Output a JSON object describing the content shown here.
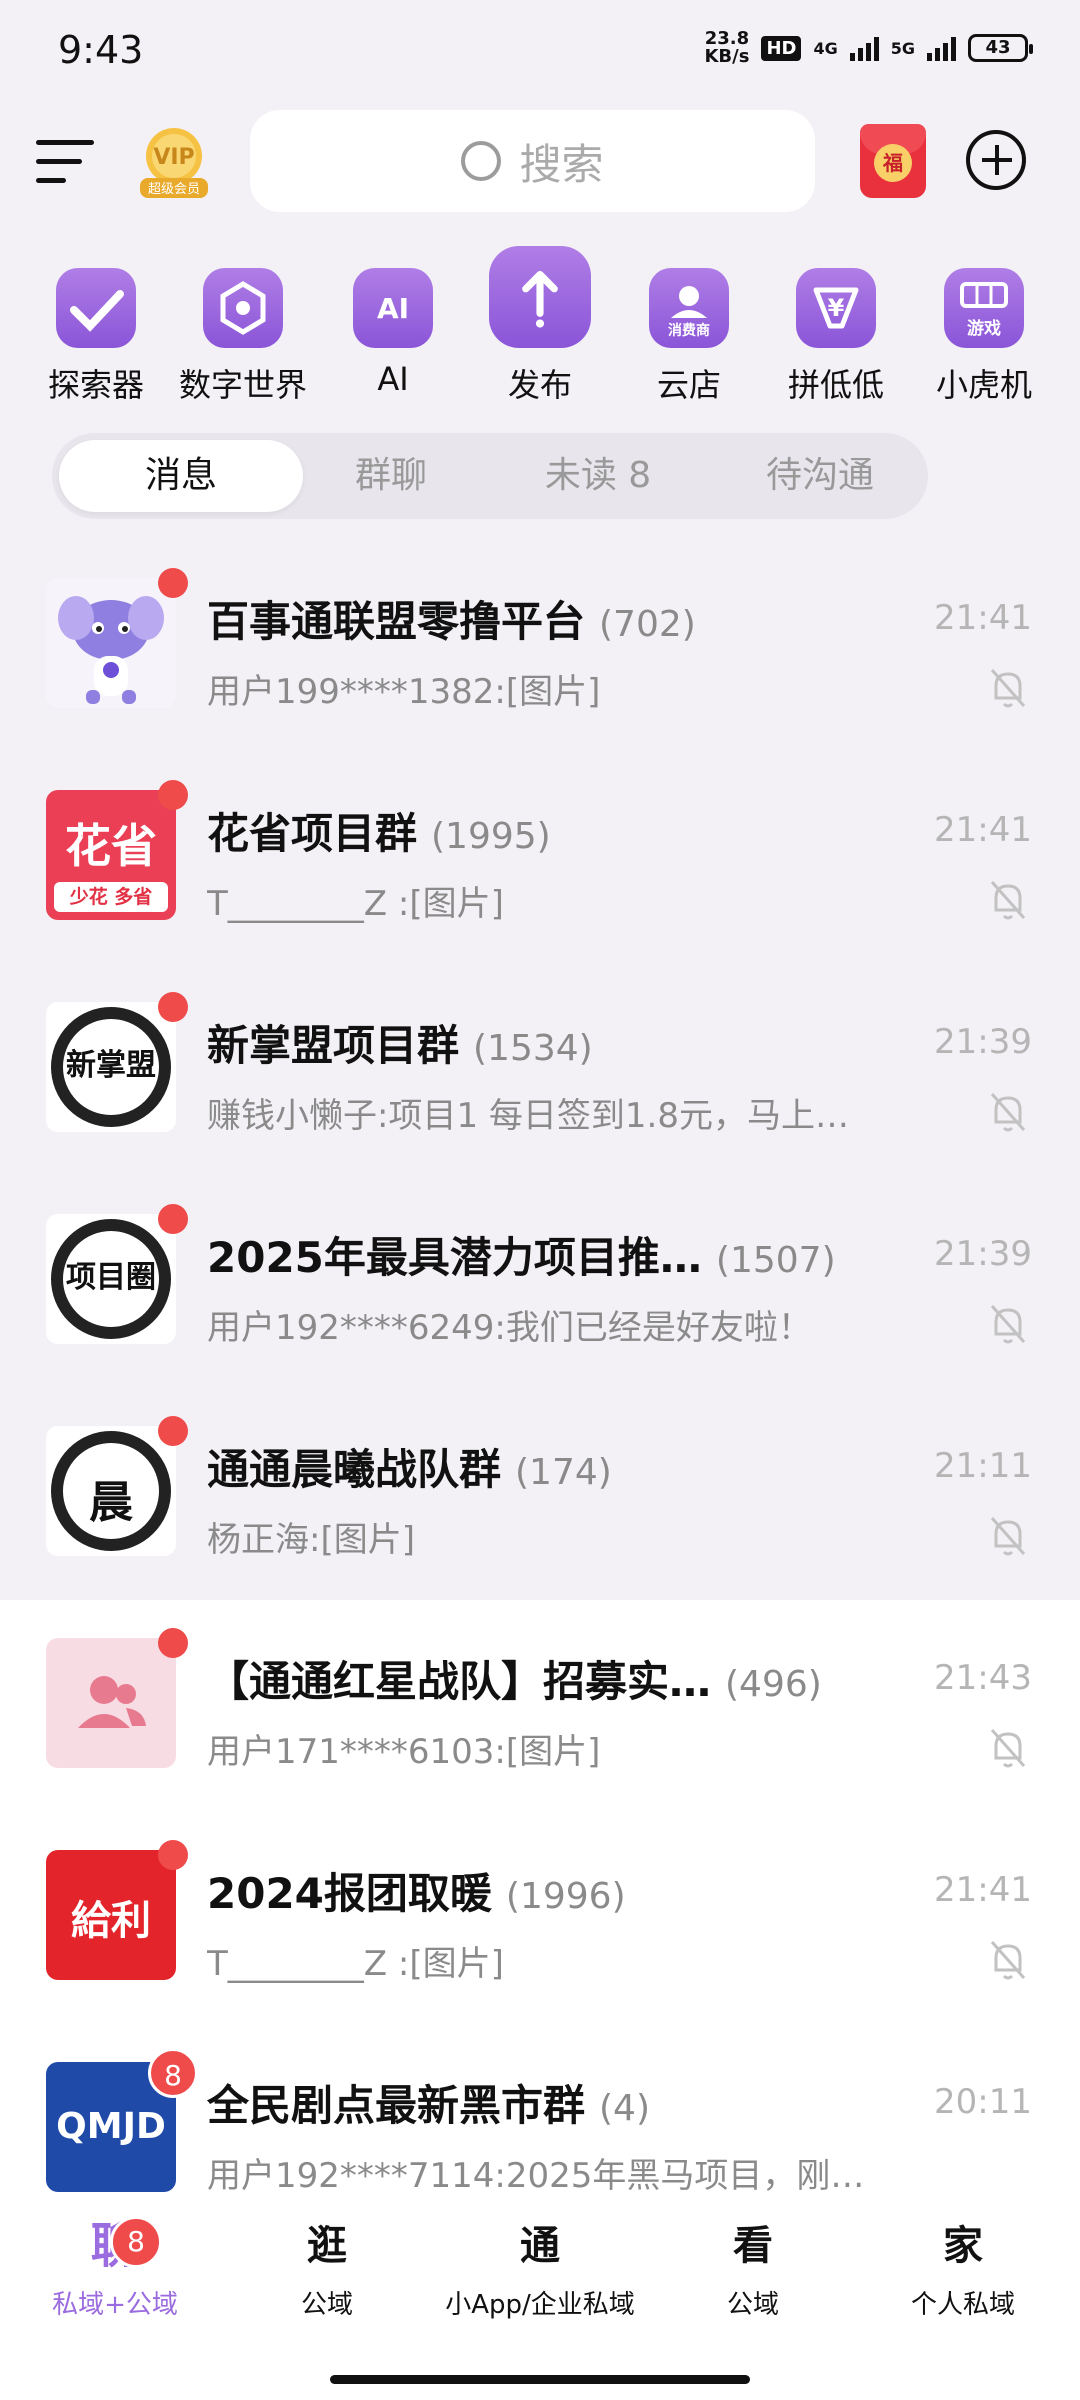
{
  "status_bar": {
    "time": "9:43",
    "net_speed_value": "23.8",
    "net_speed_unit": "KB/s",
    "hd": "HD",
    "net1": "4G",
    "net2": "5G",
    "battery": "43"
  },
  "header": {
    "vip_label": "超级会员",
    "search_placeholder": "搜索",
    "redpacket_char": "福"
  },
  "shortcuts": [
    {
      "label": "探索器",
      "icon": "explorer-icon"
    },
    {
      "label": "数字世界",
      "icon": "digital-world-icon"
    },
    {
      "label": "AI",
      "icon": "ai-icon",
      "glyph": "AI"
    },
    {
      "label": "发布",
      "icon": "publish-icon"
    },
    {
      "label": "云店",
      "icon": "cloud-store-icon",
      "glyph": "消费商"
    },
    {
      "label": "拼低低",
      "icon": "pindidi-icon",
      "glyph": "¥"
    },
    {
      "label": "小虎机",
      "icon": "tiger-machine-icon",
      "glyph": "游戏"
    }
  ],
  "tabs": [
    "消息",
    "群聊",
    "未读 8",
    "待沟通"
  ],
  "chats": [
    {
      "title": "百事通联盟零撸平台",
      "members": "(702)",
      "time": "21:41",
      "preview": "用户199****1382:[图片]",
      "avatar": "mascot"
    },
    {
      "title": "花省项目群",
      "members": "(1995)",
      "time": "21:41",
      "preview": "T________Z :[图片]",
      "avatar": "huasheng",
      "avatar_text": "花省",
      "avatar_sub": "少花 多省"
    },
    {
      "title": "新掌盟项目群",
      "members": "(1534)",
      "time": "21:39",
      "preview": "赚钱小懒子:项目1 每日签到1.8元，马上…",
      "avatar": "ink",
      "avatar_text": "新掌盟"
    },
    {
      "title": "2025年最具潜力项目推…",
      "members": "(1507)",
      "time": "21:39",
      "preview": "用户192****6249:我们已经是好友啦！",
      "avatar": "ink",
      "avatar_text": "项目圈"
    },
    {
      "title": "通通晨曦战队群",
      "members": "(174)",
      "time": "21:11",
      "preview": "杨正海:[图片]",
      "avatar": "ink",
      "avatar_text": "晨"
    },
    {
      "title": "【通通红星战队】招募实…",
      "members": "(496)",
      "time": "21:43",
      "preview": "用户171****6103:[图片]",
      "avatar": "group"
    },
    {
      "title": "2024报团取暖",
      "members": "(1996)",
      "time": "21:41",
      "preview": "T________Z :[图片]",
      "avatar": "geli",
      "avatar_text": "給利"
    },
    {
      "title": "全民剧点最新黑市群",
      "members": "(4)",
      "time": "20:11",
      "preview": "用户192****7114:2025年黑马项目，刚…",
      "avatar": "qmjd",
      "avatar_text": "QMJD",
      "badge": "8"
    }
  ],
  "bottom_nav": [
    {
      "icon": "聊",
      "label": "私域+公域",
      "badge": "8"
    },
    {
      "icon": "逛",
      "label": "公域"
    },
    {
      "icon": "通",
      "label": "小App/企业私域"
    },
    {
      "icon": "看",
      "label": "公域"
    },
    {
      "icon": "家",
      "label": "个人私域"
    }
  ]
}
